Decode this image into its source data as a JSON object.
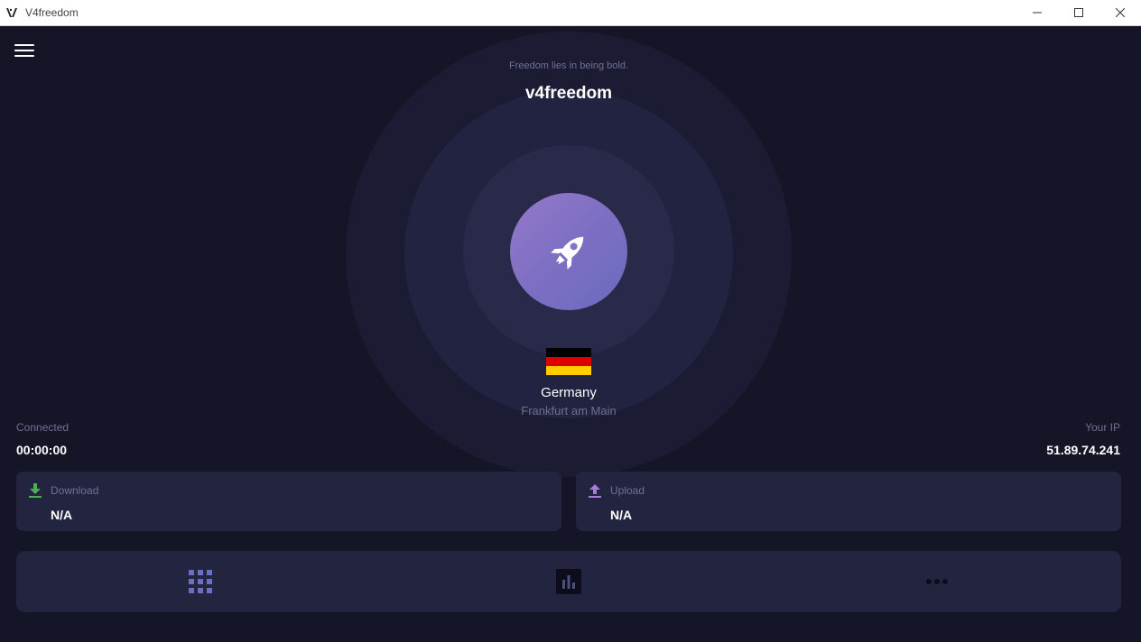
{
  "window": {
    "title": "V4freedom"
  },
  "header": {
    "tagline": "Freedom lies in being bold.",
    "brand": "v4freedom"
  },
  "location": {
    "country": "Germany",
    "city": "Frankfurt am Main"
  },
  "stats": {
    "connected_label": "Connected",
    "connected_time": "00:00:00",
    "ip_label": "Your IP",
    "ip_value": "51.89.74.241"
  },
  "traffic": {
    "download": {
      "label": "Download",
      "value": "N/A"
    },
    "upload": {
      "label": "Upload",
      "value": "N/A"
    }
  },
  "nav": {
    "items": [
      "grid-icon",
      "bar-chart-icon",
      "more-icon"
    ]
  },
  "colors": {
    "background": "#151528",
    "card": "#232440",
    "accent": "#8a74c6",
    "download_icon": "#4caf50",
    "upload_icon": "#a57cd6",
    "flag_black": "#000000",
    "flag_red": "#dd0000",
    "flag_gold": "#ffce00"
  }
}
